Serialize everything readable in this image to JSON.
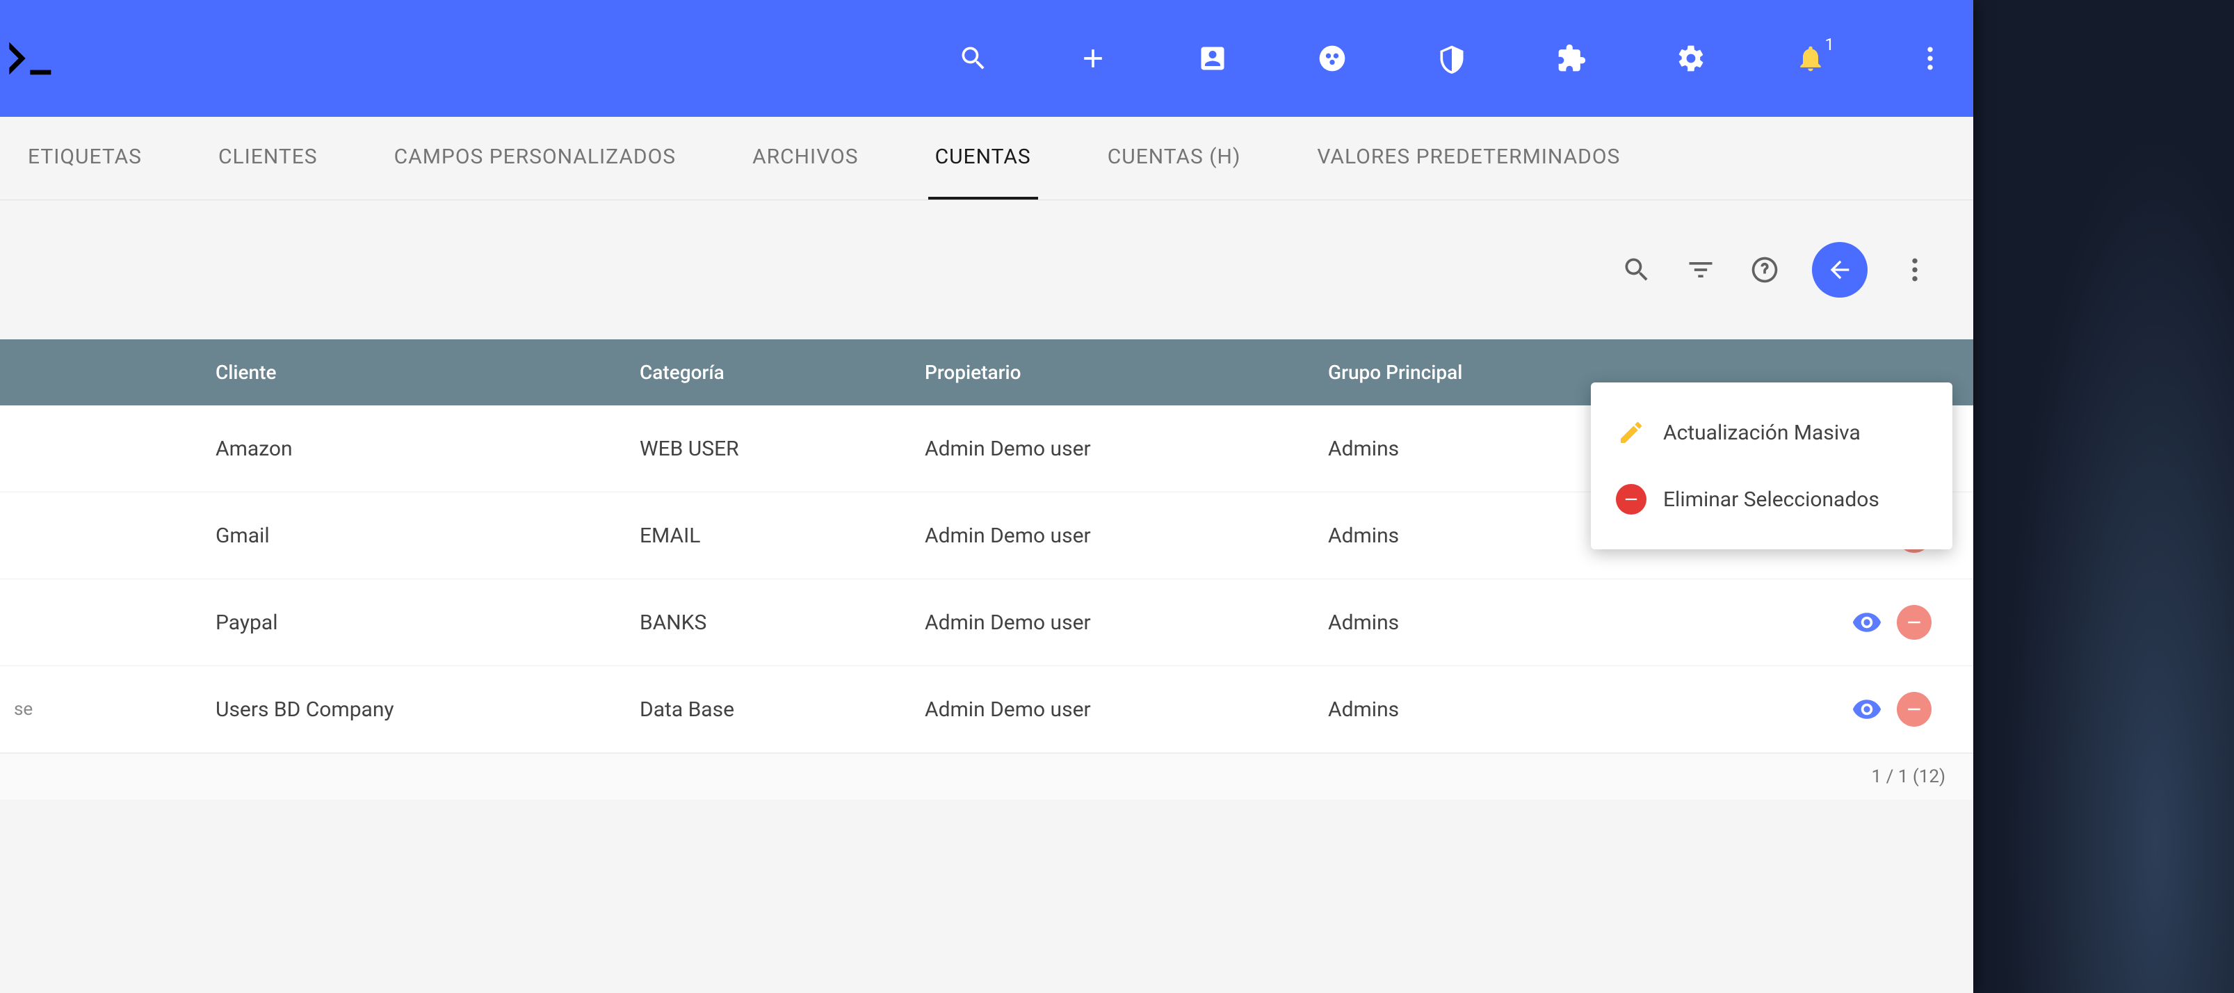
{
  "topbar": {
    "notification_count": "1"
  },
  "tabs": [
    {
      "label": "ETIQUETAS",
      "active": false
    },
    {
      "label": "CLIENTES",
      "active": false
    },
    {
      "label": "CAMPOS PERSONALIZADOS",
      "active": false
    },
    {
      "label": "ARCHIVOS",
      "active": false
    },
    {
      "label": "CUENTAS",
      "active": true
    },
    {
      "label": "CUENTAS (H)",
      "active": false
    },
    {
      "label": "VALORES PREDETERMINADOS",
      "active": false
    }
  ],
  "table": {
    "headers": {
      "client": "Cliente",
      "category": "Categoría",
      "owner": "Propietario",
      "group": "Grupo Principal"
    },
    "rows": [
      {
        "pre": "",
        "client": "Amazon",
        "category": "WEB USER",
        "owner": "Admin Demo user",
        "group": "Admins"
      },
      {
        "pre": "",
        "client": "Gmail",
        "category": "EMAIL",
        "owner": "Admin Demo user",
        "group": "Admins"
      },
      {
        "pre": "",
        "client": "Paypal",
        "category": "BANKS",
        "owner": "Admin Demo user",
        "group": "Admins"
      },
      {
        "pre": "se",
        "client": "Users BD Company",
        "category": "Data Base",
        "owner": "Admin Demo user",
        "group": "Admins"
      }
    ]
  },
  "dropdown": {
    "bulk_update": "Actualización Masiva",
    "delete_selected": "Eliminar Seleccionados"
  },
  "footer": {
    "pagination": "1 / 1 (12)"
  }
}
